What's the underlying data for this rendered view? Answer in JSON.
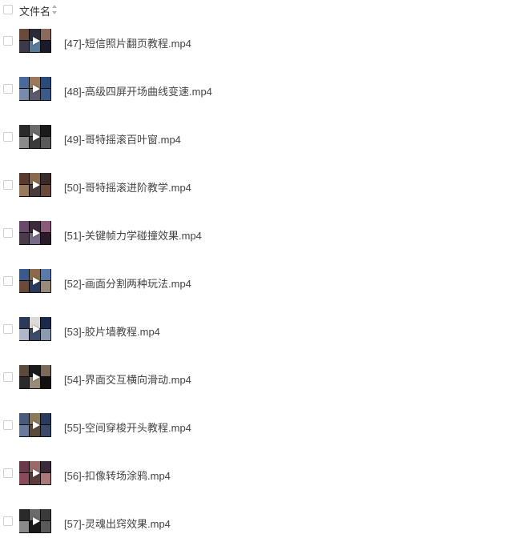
{
  "header": {
    "column_label": "文件名"
  },
  "files": [
    {
      "name": "[47]-短信照片翻页教程.mp4",
      "thumb": [
        "#6a4a3a",
        "#2a2a3a",
        "#8a6a5a",
        "#3a3a4a",
        "#5a7a9a",
        "#1a1a2a"
      ]
    },
    {
      "name": "[48]-高级四屏开场曲线变速.mp4",
      "thumb": [
        "#4a6a9a",
        "#9a7a5a",
        "#2a4a7a",
        "#7a8aaa",
        "#5a5a6a",
        "#3a5a8a"
      ]
    },
    {
      "name": "[49]-哥特摇滚百叶窗.mp4",
      "thumb": [
        "#2a2a2a",
        "#6a6a6a",
        "#1a1a1a",
        "#8a8a8a",
        "#3a3a3a",
        "#5a5a5a"
      ]
    },
    {
      "name": "[50]-哥特摇滚进阶教学.mp4",
      "thumb": [
        "#5a3a2a",
        "#8a6a4a",
        "#3a2a2a",
        "#9a7a5a",
        "#4a3a3a",
        "#6a4a3a"
      ]
    },
    {
      "name": "[51]-关键帧力学碰撞效果.mp4",
      "thumb": [
        "#6a4a6a",
        "#3a2a3a",
        "#8a5a7a",
        "#4a3a4a",
        "#7a6a8a",
        "#2a1a2a"
      ]
    },
    {
      "name": "[52]-画面分割两种玩法.mp4",
      "thumb": [
        "#3a5a8a",
        "#8a6a4a",
        "#5a7aaa",
        "#6a4a3a",
        "#2a3a5a",
        "#9a8a7a"
      ]
    },
    {
      "name": "[53]-胶片墙教程.mp4",
      "thumb": [
        "#2a3a5a",
        "#dadada",
        "#1a2a4a",
        "#b0b8c8",
        "#3a4a6a",
        "#8a9ab0"
      ]
    },
    {
      "name": "[54]-界面交互横向滑动.mp4",
      "thumb": [
        "#5a4a3a",
        "#1a1a1a",
        "#7a6a5a",
        "#2a2a2a",
        "#9a8a7a",
        "#111111"
      ]
    },
    {
      "name": "[55]-空间穿梭开头教程.mp4",
      "thumb": [
        "#4a5a7a",
        "#8a7a5a",
        "#2a3a5a",
        "#6a7a9a",
        "#5a4a3a",
        "#3a4a6a"
      ]
    },
    {
      "name": "[56]-扣像转场涂鸦.mp4",
      "thumb": [
        "#6a3a4a",
        "#9a6a6a",
        "#3a2a3a",
        "#8a4a5a",
        "#5a3a3a",
        "#aa7a7a"
      ]
    },
    {
      "name": "[57]-灵魂出窍效果.mp4",
      "thumb": [
        "#2a2a2a",
        "#6a6a6a",
        "#3a3a3a",
        "#8a8a8a",
        "#1a1a1a",
        "#5a5a5a"
      ]
    }
  ]
}
